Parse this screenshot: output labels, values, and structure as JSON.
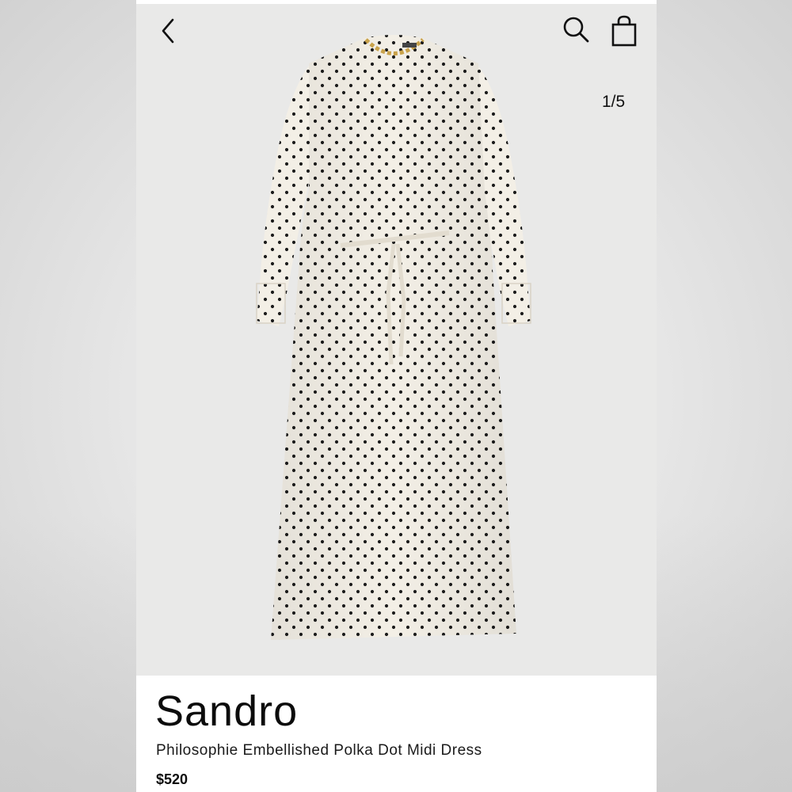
{
  "header": {
    "back_icon": "chevron-left-icon",
    "search_icon": "search-icon",
    "bag_icon": "shopping-bag-icon",
    "image_counter": "1/5"
  },
  "product": {
    "brand": "Sandro",
    "name": "Philosophie Embellished Polka Dot Midi Dress",
    "price": "$520",
    "image": {
      "pattern": "polka-dot",
      "fabric_color": "#f3efe6",
      "dot_color": "#1c1c1c",
      "detail_color": "#c9a24a"
    }
  },
  "colors": {
    "hero_background": "#e9e9e8",
    "text": "#0c0c0c"
  }
}
